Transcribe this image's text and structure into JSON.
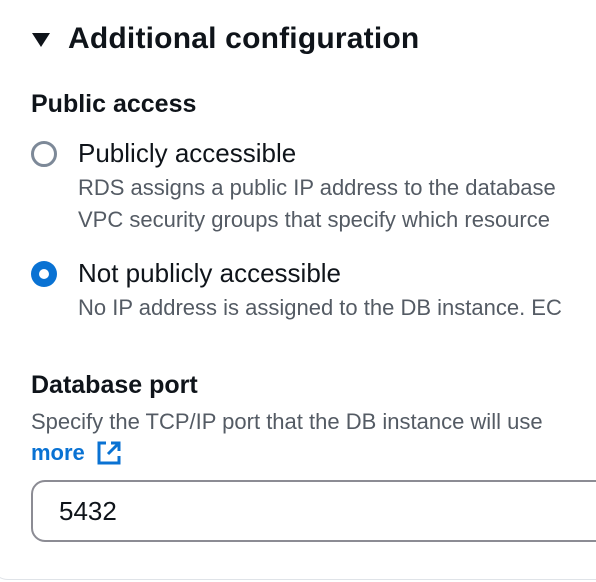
{
  "section": {
    "title": "Additional configuration"
  },
  "public_access": {
    "label": "Public access",
    "options": [
      {
        "label": "Publicly accessible",
        "description_line1": "RDS assigns a public IP address to the database",
        "description_line2": "VPC security groups that specify which resource",
        "selected": false
      },
      {
        "label": "Not publicly accessible",
        "description_line1": "No IP address is assigned to the DB instance. EC",
        "selected": true
      }
    ]
  },
  "database_port": {
    "label": "Database port",
    "helper": "Specify the TCP/IP port that the DB instance will use",
    "learn_more": "more",
    "value": "5432"
  },
  "icons": {
    "caret": "caret-down-icon",
    "external_link": "external-link-icon"
  },
  "colors": {
    "accent": "#0972d3",
    "text": "#0f141a",
    "secondary_text": "#545b64",
    "border": "#8c8c94"
  }
}
